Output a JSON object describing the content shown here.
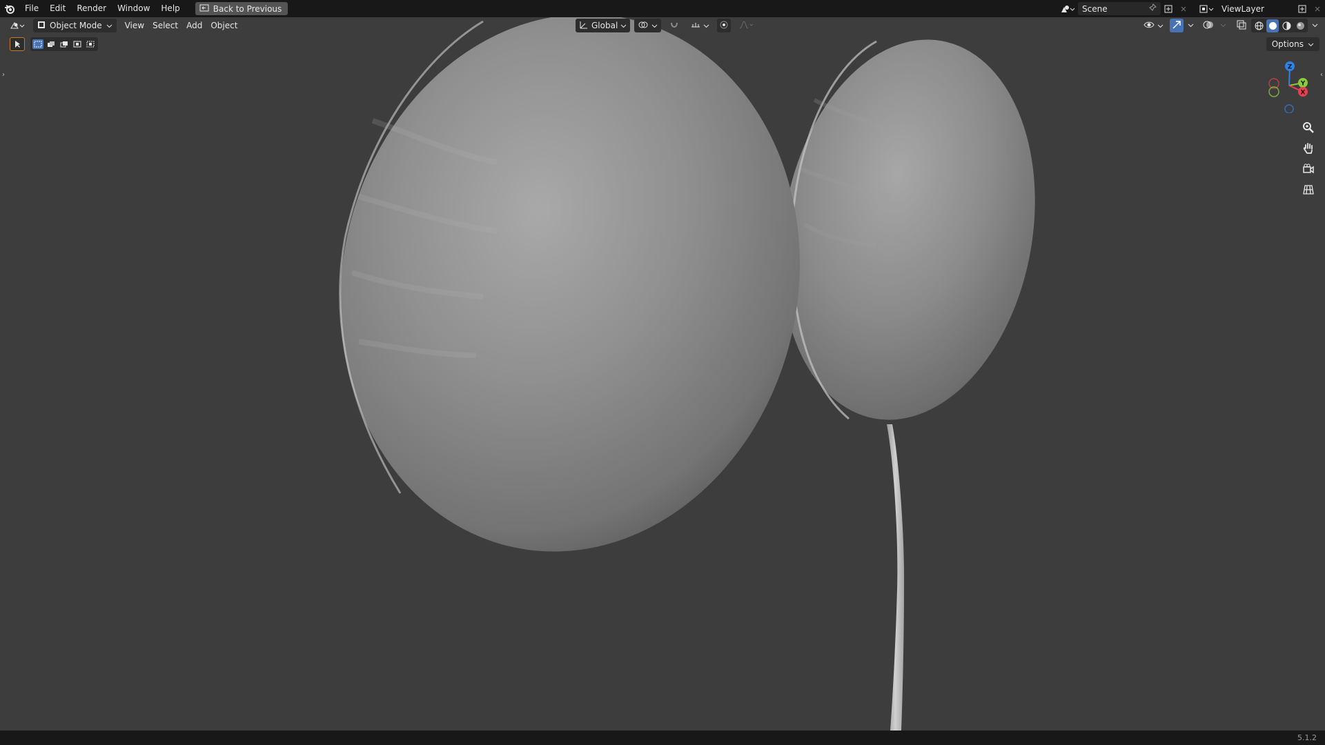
{
  "menubar": {
    "items": [
      "File",
      "Edit",
      "Render",
      "Window",
      "Help"
    ],
    "back_button": "Back to Previous",
    "scene_name": "Scene",
    "view_layer": "ViewLayer"
  },
  "viewport_header": {
    "mode": "Object Mode",
    "menus": [
      "View",
      "Select",
      "Add",
      "Object"
    ],
    "orientation": "Global",
    "options": "Options"
  },
  "gizmo": {
    "z": "Z",
    "y": "Y",
    "x": "X"
  },
  "status": {
    "version": "5.1.2"
  },
  "colors": {
    "accent": "#4772b3",
    "active_tool": "#c77b1c",
    "x_axis": "#e8414e",
    "y_axis": "#8bc93e",
    "z_axis": "#2f82e6"
  },
  "icons": [
    "blender-logo",
    "back-icon",
    "scene-icon",
    "pin-icon",
    "new-icon",
    "close-icon",
    "view-layer-icon",
    "editor-type-icon",
    "object-mode-icon",
    "transform-orientation-icon",
    "pivot-icon",
    "snap-icon",
    "snap-increment-icon",
    "proportional-edit-icon",
    "falloff-icon",
    "visibility-icon",
    "gizmo-icon",
    "overlay-icon",
    "xray-icon",
    "wireframe-shading-icon",
    "solid-shading-icon",
    "material-shading-icon",
    "rendered-shading-icon",
    "select-tool-icon",
    "zoom-icon",
    "hand-icon",
    "camera-icon",
    "grid-icon"
  ]
}
